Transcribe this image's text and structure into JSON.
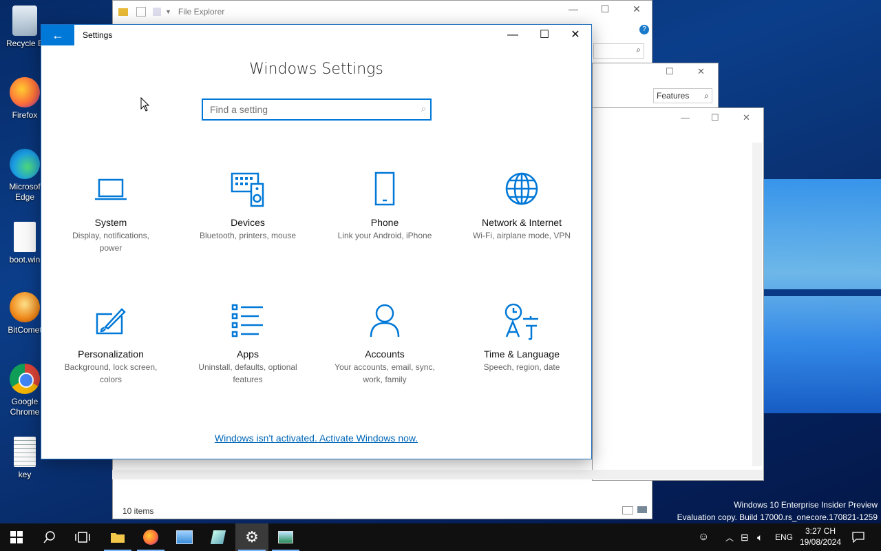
{
  "desktop": {
    "icons": [
      {
        "label": "Recycle B",
        "icon": "recycle-bin-icon"
      },
      {
        "label": "Firefox",
        "icon": "firefox-icon"
      },
      {
        "label": "Microsof\nEdge",
        "icon": "edge-icon"
      },
      {
        "label": "boot.win",
        "icon": "file-icon"
      },
      {
        "label": "BitComet",
        "icon": "bitcomet-icon"
      },
      {
        "label": "Google\nChrome",
        "icon": "chrome-icon"
      },
      {
        "label": "key",
        "icon": "text-file-icon"
      }
    ]
  },
  "file_explorer": {
    "title": "File Explorer",
    "status": "10 items",
    "search_hint": "Features"
  },
  "settings": {
    "window_title": "Settings",
    "heading": "Windows Settings",
    "search_placeholder": "Find a setting",
    "categories": [
      {
        "title": "System",
        "desc": "Display, notifications,\npower",
        "icon": "laptop-icon"
      },
      {
        "title": "Devices",
        "desc": "Bluetooth, printers, mouse",
        "icon": "keyboard-speaker-icon"
      },
      {
        "title": "Phone",
        "desc": "Link your Android, iPhone",
        "icon": "phone-icon"
      },
      {
        "title": "Network & Internet",
        "desc": "Wi-Fi, airplane mode, VPN",
        "icon": "globe-icon"
      },
      {
        "title": "Personalization",
        "desc": "Background, lock screen,\ncolors",
        "icon": "paintbrush-icon"
      },
      {
        "title": "Apps",
        "desc": "Uninstall, defaults, optional\nfeatures",
        "icon": "apps-list-icon"
      },
      {
        "title": "Accounts",
        "desc": "Your accounts, email, sync,\nwork, family",
        "icon": "person-icon"
      },
      {
        "title": "Time & Language",
        "desc": "Speech, region, date",
        "icon": "time-language-icon"
      }
    ],
    "activate_link": "Windows isn't activated. Activate Windows now."
  },
  "watermark": {
    "line1": "Windows 10 Enterprise Insider Preview",
    "line2": "Evaluation copy. Build 17000.rs_onecore.170821-1259"
  },
  "taskbar": {
    "language": "ENG",
    "time": "3:27 CH",
    "date": "19/08/2024"
  },
  "colors": {
    "accent": "#0078d7",
    "link": "#0067b8",
    "taskbar": "#101010"
  }
}
